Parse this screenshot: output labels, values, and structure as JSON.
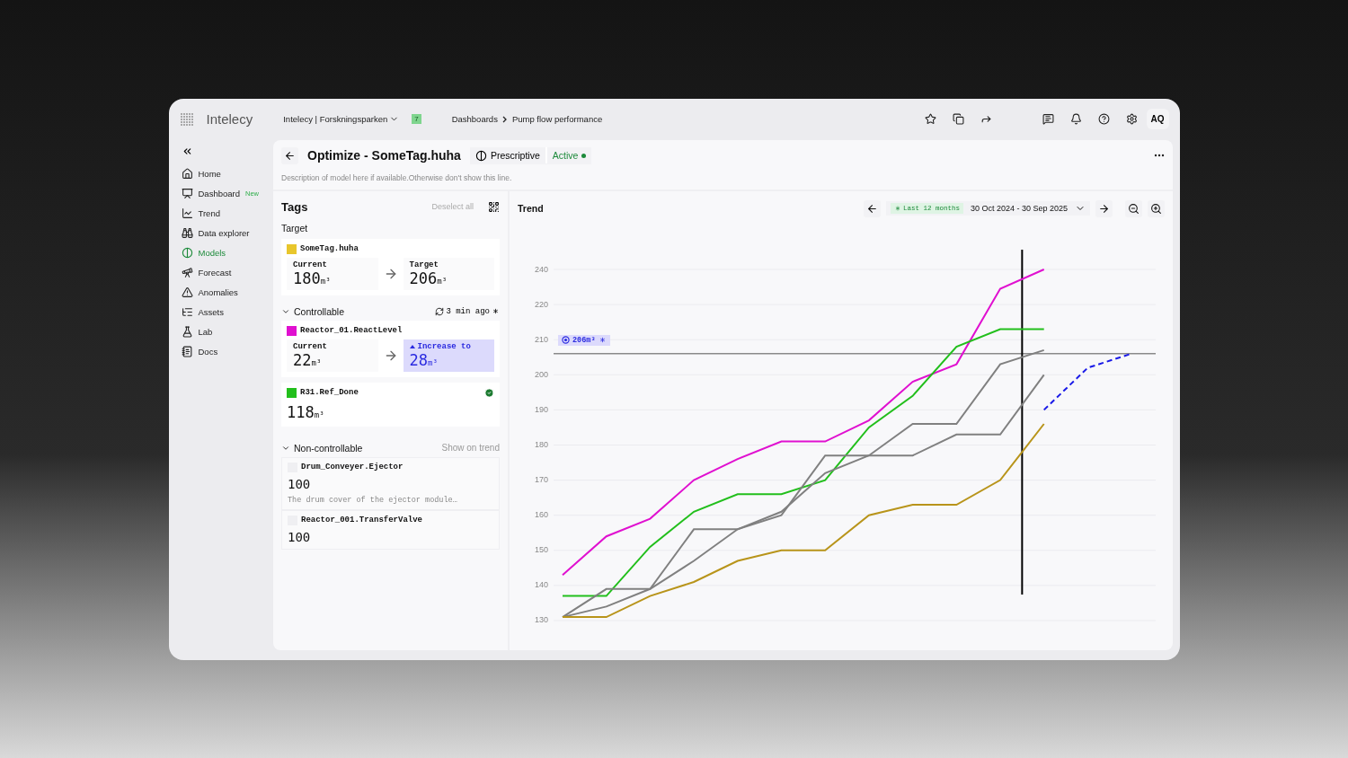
{
  "app": {
    "logo": "Intelecy",
    "workspace": "Intelecy | Forskningsparken",
    "workspace_badge": "7",
    "breadcrumbs": [
      "Dashboards",
      "Pump flow performance"
    ],
    "user_initials": "AQ"
  },
  "sidebar": {
    "items": [
      {
        "label": "Home",
        "selected": false
      },
      {
        "label": "Dashboard",
        "badge": "New",
        "selected": false
      },
      {
        "label": "Trend",
        "selected": false
      },
      {
        "label": "Data explorer",
        "selected": false
      },
      {
        "label": "Models",
        "selected": true
      },
      {
        "label": "Forecast",
        "selected": false
      },
      {
        "label": "Anomalies",
        "selected": false
      },
      {
        "label": "Assets",
        "selected": false
      },
      {
        "label": "Lab",
        "selected": false
      },
      {
        "label": "Docs",
        "selected": false
      }
    ]
  },
  "header": {
    "title": "Optimize - SomeTag.huha",
    "type": "Prescriptive",
    "status": "Active",
    "description": "Description of model here if available.Otherwise don't show this line."
  },
  "tags": {
    "title": "Tags",
    "deselect": "Deselect all",
    "target": {
      "heading": "Target",
      "name": "SomeTag.huha",
      "color": "#e8c62c",
      "current_label": "Current",
      "current": "180",
      "current_unit": "m³",
      "target_label": "Target",
      "target": "206",
      "target_unit": "m³"
    },
    "controllable": {
      "heading": "Controllable",
      "expanded": true,
      "updated": "3 min ago",
      "tags": [
        {
          "kind": "recommend",
          "name": "Reactor_01.ReactLevel",
          "color": "#e010d0",
          "current_label": "Current",
          "current": "22",
          "current_unit": "m³",
          "recommend_label": "Increase to",
          "recommend": "28",
          "recommend_unit": "m³"
        },
        {
          "kind": "value",
          "name": "R31.Ref_Done",
          "color": "#22bf1c",
          "value": "118",
          "unit": "m³",
          "done": true
        }
      ]
    },
    "non_controllable": {
      "heading": "Non-controllable",
      "expanded": true,
      "action": "Show on trend",
      "tags": [
        {
          "name": "Drum_Conveyer.Ejector",
          "checked": false,
          "value": "100",
          "description": "The drum cover of the ejector module…"
        },
        {
          "name": "Reactor_001.TransferValve",
          "checked": false,
          "value": "100"
        }
      ]
    }
  },
  "trend": {
    "title": "Trend",
    "range_chip": "Last 12 months",
    "range": "30 Oct 2024 - 30 Sep 2025",
    "y_axis_labels": [
      "240",
      "220",
      "210",
      "200",
      "190",
      "180",
      "170",
      "160",
      "150",
      "140",
      "130"
    ],
    "target_label": "206m³"
  }
}
